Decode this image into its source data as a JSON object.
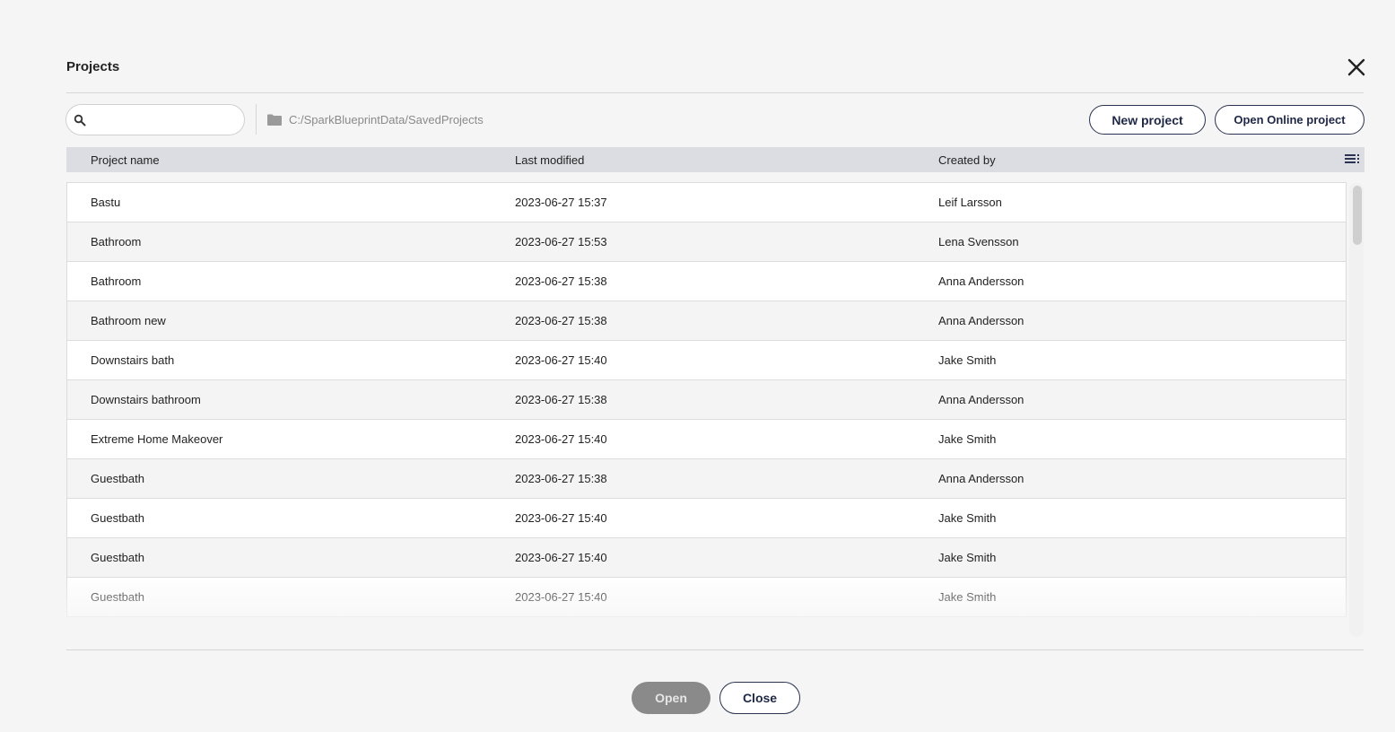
{
  "dialog": {
    "title": "Projects",
    "search": {
      "value": "",
      "placeholder": ""
    },
    "path": "C:/SparkBlueprintData/SavedProjects",
    "new_project_label": "New project",
    "open_online_label": "Open Online project",
    "open_label": "Open",
    "close_label": "Close"
  },
  "table": {
    "headers": [
      "Project name",
      "Last modified",
      "Created by"
    ],
    "rows": [
      [
        "Bastu",
        "2023-06-27 15:37",
        "Leif Larsson"
      ],
      [
        "Bathroom",
        "2023-06-27 15:53",
        "Lena Svensson"
      ],
      [
        "Bathroom",
        "2023-06-27 15:38",
        "Anna Andersson"
      ],
      [
        "Bathroom new",
        "2023-06-27 15:38",
        "Anna Andersson"
      ],
      [
        "Downstairs bath",
        "2023-06-27 15:40",
        "Jake Smith"
      ],
      [
        "Downstairs bathroom",
        "2023-06-27 15:38",
        "Anna Andersson"
      ],
      [
        "Extreme Home Makeover",
        "2023-06-27 15:40",
        "Jake Smith"
      ],
      [
        "Guestbath",
        "2023-06-27 15:38",
        "Anna Andersson"
      ],
      [
        "Guestbath",
        "2023-06-27 15:40",
        "Jake Smith"
      ],
      [
        "Guestbath",
        "2023-06-27 15:40",
        "Jake Smith"
      ],
      [
        "Guestbath",
        "2023-06-27 15:40",
        "Jake Smith"
      ]
    ]
  },
  "colors": {
    "accent": "#2b3350",
    "header_bg": "#dcdde2",
    "disabled_button": "#8a8a8a"
  },
  "icons": [
    "close-icon",
    "search-icon",
    "folder-icon",
    "column-settings-icon"
  ]
}
